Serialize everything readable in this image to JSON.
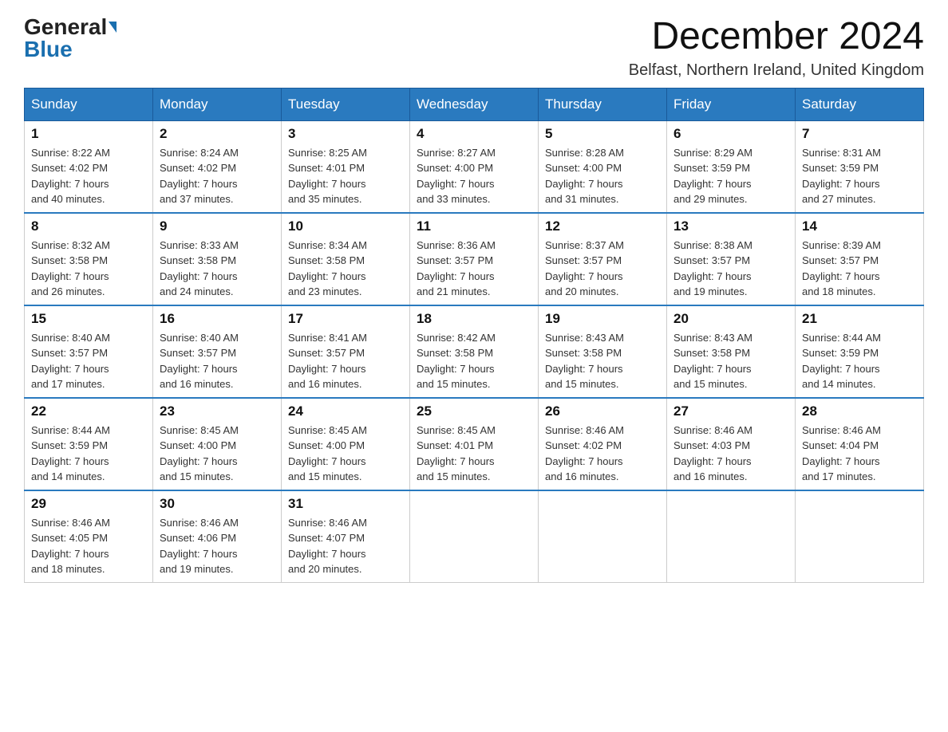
{
  "header": {
    "logo_general": "General",
    "logo_blue": "Blue",
    "month_year": "December 2024",
    "location": "Belfast, Northern Ireland, United Kingdom"
  },
  "days_of_week": [
    "Sunday",
    "Monday",
    "Tuesday",
    "Wednesday",
    "Thursday",
    "Friday",
    "Saturday"
  ],
  "weeks": [
    [
      {
        "day": "1",
        "sunrise": "8:22 AM",
        "sunset": "4:02 PM",
        "daylight": "7 hours and 40 minutes."
      },
      {
        "day": "2",
        "sunrise": "8:24 AM",
        "sunset": "4:02 PM",
        "daylight": "7 hours and 37 minutes."
      },
      {
        "day": "3",
        "sunrise": "8:25 AM",
        "sunset": "4:01 PM",
        "daylight": "7 hours and 35 minutes."
      },
      {
        "day": "4",
        "sunrise": "8:27 AM",
        "sunset": "4:00 PM",
        "daylight": "7 hours and 33 minutes."
      },
      {
        "day": "5",
        "sunrise": "8:28 AM",
        "sunset": "4:00 PM",
        "daylight": "7 hours and 31 minutes."
      },
      {
        "day": "6",
        "sunrise": "8:29 AM",
        "sunset": "3:59 PM",
        "daylight": "7 hours and 29 minutes."
      },
      {
        "day": "7",
        "sunrise": "8:31 AM",
        "sunset": "3:59 PM",
        "daylight": "7 hours and 27 minutes."
      }
    ],
    [
      {
        "day": "8",
        "sunrise": "8:32 AM",
        "sunset": "3:58 PM",
        "daylight": "7 hours and 26 minutes."
      },
      {
        "day": "9",
        "sunrise": "8:33 AM",
        "sunset": "3:58 PM",
        "daylight": "7 hours and 24 minutes."
      },
      {
        "day": "10",
        "sunrise": "8:34 AM",
        "sunset": "3:58 PM",
        "daylight": "7 hours and 23 minutes."
      },
      {
        "day": "11",
        "sunrise": "8:36 AM",
        "sunset": "3:57 PM",
        "daylight": "7 hours and 21 minutes."
      },
      {
        "day": "12",
        "sunrise": "8:37 AM",
        "sunset": "3:57 PM",
        "daylight": "7 hours and 20 minutes."
      },
      {
        "day": "13",
        "sunrise": "8:38 AM",
        "sunset": "3:57 PM",
        "daylight": "7 hours and 19 minutes."
      },
      {
        "day": "14",
        "sunrise": "8:39 AM",
        "sunset": "3:57 PM",
        "daylight": "7 hours and 18 minutes."
      }
    ],
    [
      {
        "day": "15",
        "sunrise": "8:40 AM",
        "sunset": "3:57 PM",
        "daylight": "7 hours and 17 minutes."
      },
      {
        "day": "16",
        "sunrise": "8:40 AM",
        "sunset": "3:57 PM",
        "daylight": "7 hours and 16 minutes."
      },
      {
        "day": "17",
        "sunrise": "8:41 AM",
        "sunset": "3:57 PM",
        "daylight": "7 hours and 16 minutes."
      },
      {
        "day": "18",
        "sunrise": "8:42 AM",
        "sunset": "3:58 PM",
        "daylight": "7 hours and 15 minutes."
      },
      {
        "day": "19",
        "sunrise": "8:43 AM",
        "sunset": "3:58 PM",
        "daylight": "7 hours and 15 minutes."
      },
      {
        "day": "20",
        "sunrise": "8:43 AM",
        "sunset": "3:58 PM",
        "daylight": "7 hours and 15 minutes."
      },
      {
        "day": "21",
        "sunrise": "8:44 AM",
        "sunset": "3:59 PM",
        "daylight": "7 hours and 14 minutes."
      }
    ],
    [
      {
        "day": "22",
        "sunrise": "8:44 AM",
        "sunset": "3:59 PM",
        "daylight": "7 hours and 14 minutes."
      },
      {
        "day": "23",
        "sunrise": "8:45 AM",
        "sunset": "4:00 PM",
        "daylight": "7 hours and 15 minutes."
      },
      {
        "day": "24",
        "sunrise": "8:45 AM",
        "sunset": "4:00 PM",
        "daylight": "7 hours and 15 minutes."
      },
      {
        "day": "25",
        "sunrise": "8:45 AM",
        "sunset": "4:01 PM",
        "daylight": "7 hours and 15 minutes."
      },
      {
        "day": "26",
        "sunrise": "8:46 AM",
        "sunset": "4:02 PM",
        "daylight": "7 hours and 16 minutes."
      },
      {
        "day": "27",
        "sunrise": "8:46 AM",
        "sunset": "4:03 PM",
        "daylight": "7 hours and 16 minutes."
      },
      {
        "day": "28",
        "sunrise": "8:46 AM",
        "sunset": "4:04 PM",
        "daylight": "7 hours and 17 minutes."
      }
    ],
    [
      {
        "day": "29",
        "sunrise": "8:46 AM",
        "sunset": "4:05 PM",
        "daylight": "7 hours and 18 minutes."
      },
      {
        "day": "30",
        "sunrise": "8:46 AM",
        "sunset": "4:06 PM",
        "daylight": "7 hours and 19 minutes."
      },
      {
        "day": "31",
        "sunrise": "8:46 AM",
        "sunset": "4:07 PM",
        "daylight": "7 hours and 20 minutes."
      },
      null,
      null,
      null,
      null
    ]
  ],
  "labels": {
    "sunrise": "Sunrise:",
    "sunset": "Sunset:",
    "daylight": "Daylight:"
  }
}
